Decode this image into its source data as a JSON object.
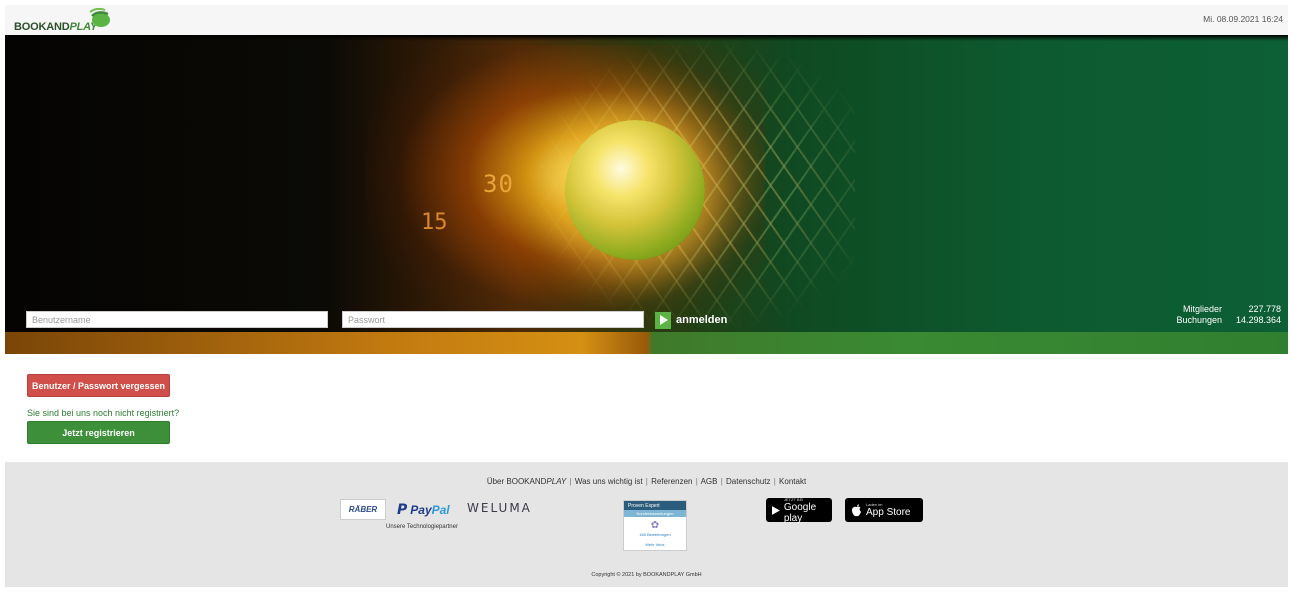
{
  "header": {
    "logo_book": "BOOKAND",
    "logo_play": "PLAY",
    "datetime": "Mi. 08.09.2021 16:24"
  },
  "hero": {
    "score_30": "30",
    "score_15": "15"
  },
  "login": {
    "username_placeholder": "Benutzername",
    "password_placeholder": "Passwort",
    "submit_label": "anmelden"
  },
  "stats": {
    "members_label": "Mitglieder",
    "members_value": "227.778",
    "bookings_label": "Buchungen",
    "bookings_value": "14.298.364"
  },
  "account": {
    "forgot_label": "Benutzer / Passwort vergessen",
    "register_question": "Sie sind bei uns noch nicht registriert?",
    "register_label": "Jetzt registrieren"
  },
  "footer": {
    "links": [
      {
        "prefix": "Über BOOKAND",
        "emphasis": "PLAY"
      },
      {
        "label": "Was uns wichtig ist"
      },
      {
        "label": "Referenzen"
      },
      {
        "label": "AGB"
      },
      {
        "label": "Datenschutz"
      },
      {
        "label": "Kontakt"
      }
    ],
    "partners": {
      "raber": "RÄBER",
      "paypal_pay": "Pay",
      "paypal_pal": "Pal",
      "weluma": "WELUMA",
      "label": "Unsere Technologiepartner"
    },
    "proven_expert": {
      "title": "Proven Expert",
      "subtitle": "Kundenbewertungen",
      "count": "180 Bewertungen",
      "more": "Mehr Infos"
    },
    "stores": {
      "google_small": "JETZT BEI",
      "google_big": "Google play",
      "apple_small": "Laden im",
      "apple_big": "App Store"
    },
    "copyright": "Copyright © 2021 by BOOKANDPLAY GmbH"
  },
  "colors": {
    "brand_green": "#3d8f3a",
    "danger_red": "#d14f4a",
    "play_green": "#5cb345"
  }
}
